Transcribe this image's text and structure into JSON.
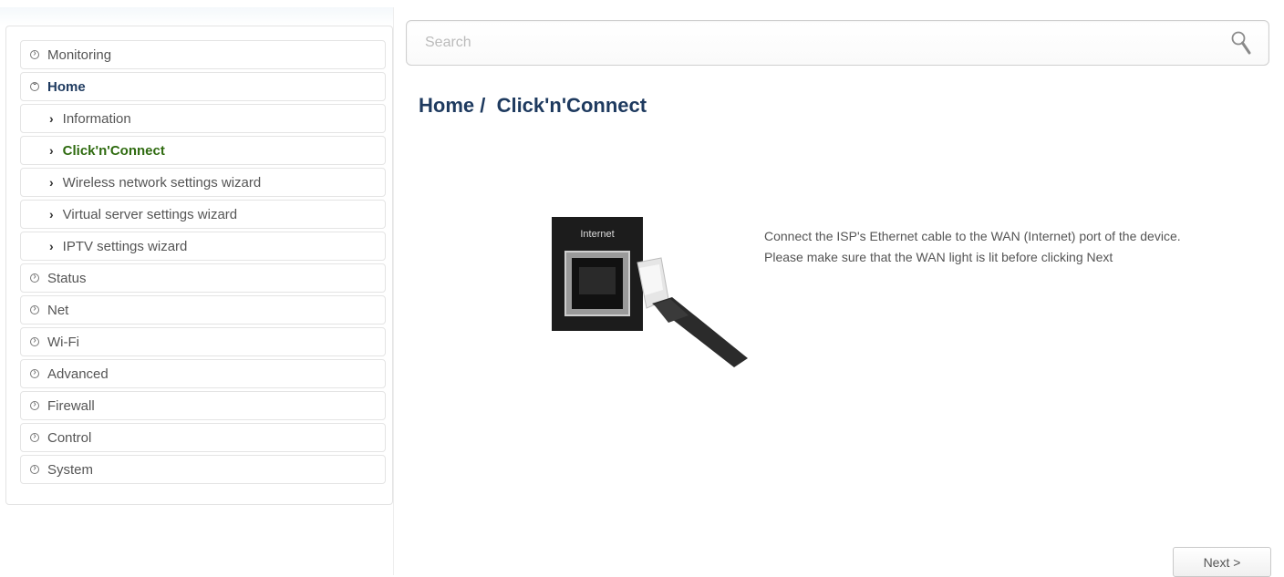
{
  "search": {
    "placeholder": "Search"
  },
  "breadcrumb": {
    "title": "Home /  Click'n'Connect"
  },
  "sidebar": {
    "items": [
      {
        "label": "Monitoring"
      },
      {
        "label": "Home"
      },
      {
        "label": "Information"
      },
      {
        "label": "Click'n'Connect"
      },
      {
        "label": "Wireless network settings wizard"
      },
      {
        "label": "Virtual server settings wizard"
      },
      {
        "label": "IPTV settings wizard"
      },
      {
        "label": "Status"
      },
      {
        "label": "Net"
      },
      {
        "label": "Wi-Fi"
      },
      {
        "label": "Advanced"
      },
      {
        "label": "Firewall"
      },
      {
        "label": "Control"
      },
      {
        "label": "System"
      }
    ]
  },
  "content": {
    "port_label": "Internet",
    "instruction_1": "Connect the ISP's Ethernet cable to the WAN (Internet) port of the device.",
    "instruction_2": "Please make sure that the WAN light is lit before clicking Next"
  },
  "footer": {
    "next_label": "Next >"
  },
  "colors": {
    "title": "#1e3a5f",
    "active_item": "#2f6b10"
  }
}
